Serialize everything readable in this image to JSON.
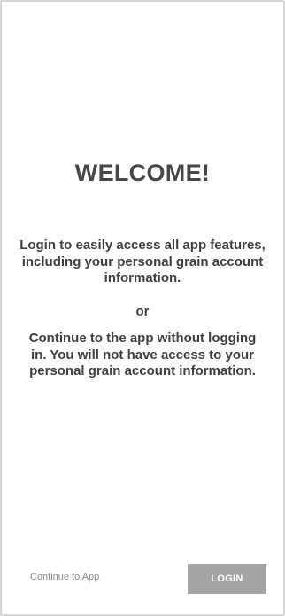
{
  "welcome": {
    "title": "WELCOME!",
    "login_message": "Login to easily access all app features, including your personal grain account information.",
    "or": "or",
    "continue_message": "Continue to the app without logging in. You will not have access to your personal grain account information."
  },
  "actions": {
    "continue_label": "Continue to App",
    "login_label": "LOGIN"
  },
  "colors": {
    "login_button_bg": "#a4a4a4",
    "title_text": "#474747"
  }
}
